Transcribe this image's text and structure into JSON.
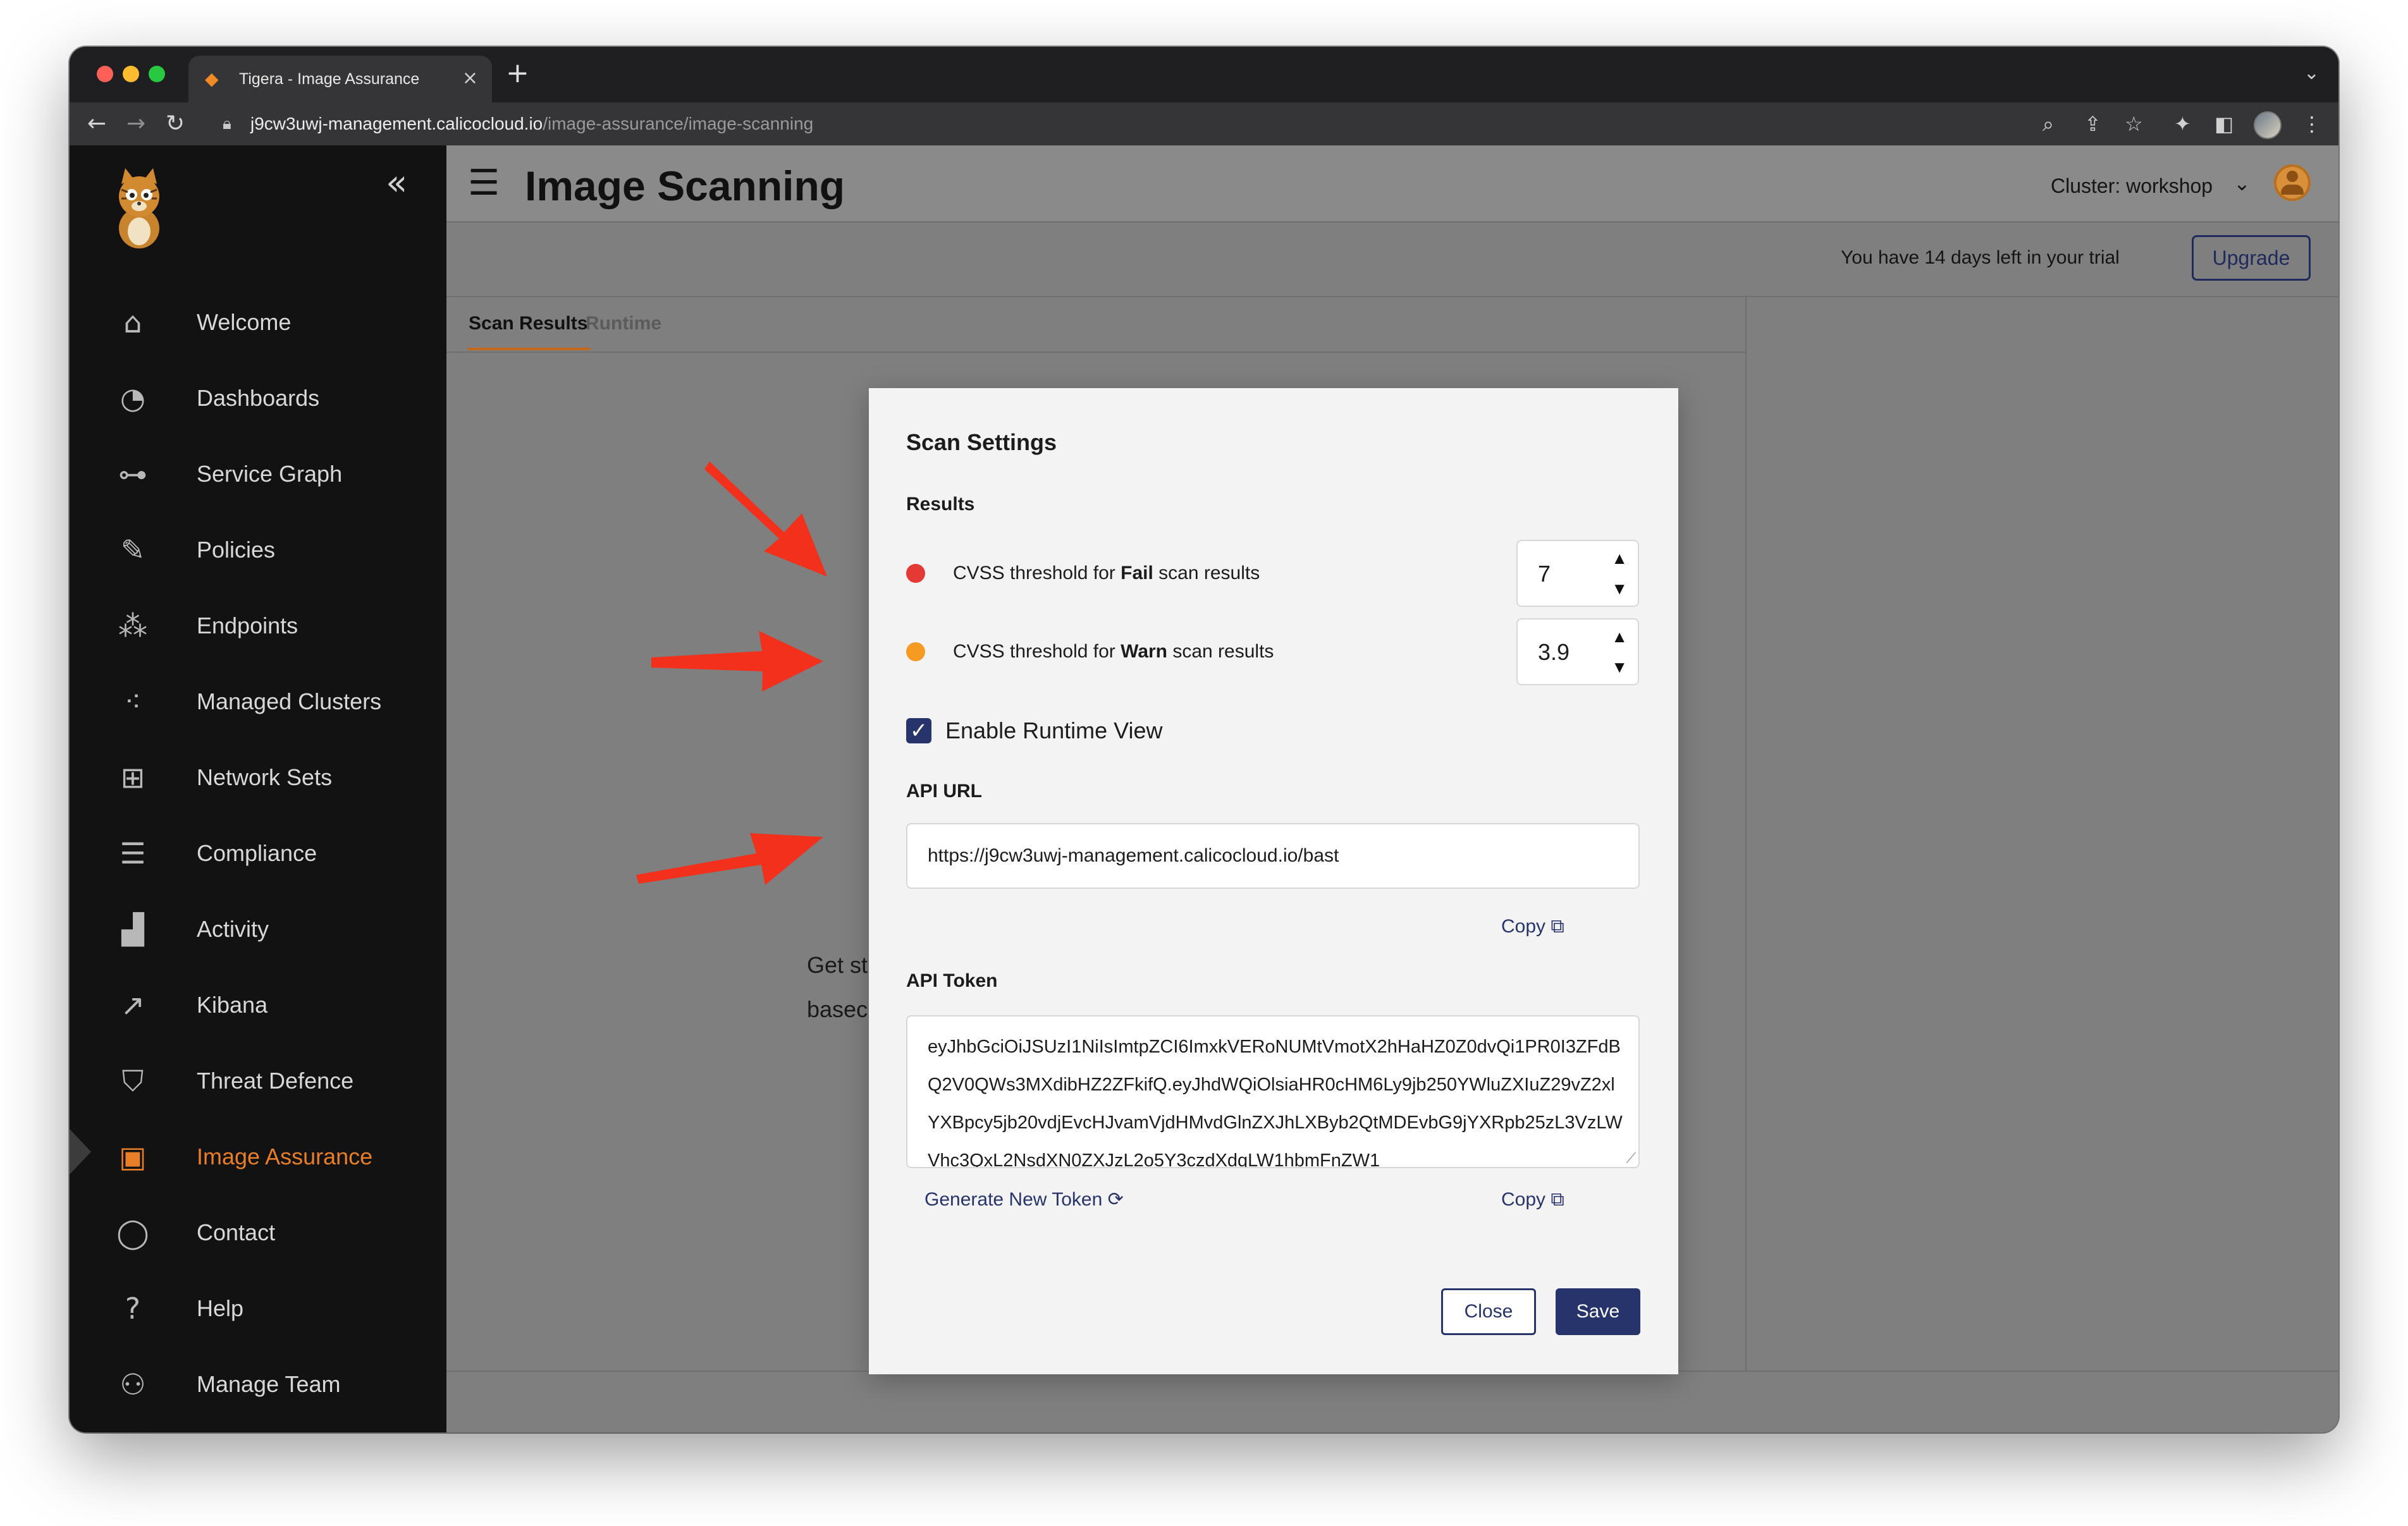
{
  "browser": {
    "tab_title": "Tigera - Image Assurance",
    "tab_close": "×",
    "new_tab": "+",
    "tab_menu": "⌄",
    "url_host": "j9cw3uwj-management.calicocloud.io",
    "url_path": "/image-assurance/image-scanning",
    "nav_back": "←",
    "nav_forward": "→",
    "nav_reload": "↻"
  },
  "sidebar": {
    "collapse_icon": "«",
    "items": [
      {
        "label": "Welcome",
        "icon": "home-icon",
        "glyph": "⌂"
      },
      {
        "label": "Dashboards",
        "icon": "dashboard-icon",
        "glyph": "◔"
      },
      {
        "label": "Service Graph",
        "icon": "service-graph-icon",
        "glyph": "⊶"
      },
      {
        "label": "Policies",
        "icon": "policies-icon",
        "glyph": "✎"
      },
      {
        "label": "Endpoints",
        "icon": "endpoints-icon",
        "glyph": "⁂"
      },
      {
        "label": "Managed Clusters",
        "icon": "managed-clusters-icon",
        "glyph": "⁖"
      },
      {
        "label": "Network Sets",
        "icon": "network-sets-icon",
        "glyph": "⊞"
      },
      {
        "label": "Compliance",
        "icon": "compliance-icon",
        "glyph": "☰"
      },
      {
        "label": "Activity",
        "icon": "activity-icon",
        "glyph": "▟"
      },
      {
        "label": "Kibana",
        "icon": "kibana-icon",
        "glyph": "↗"
      },
      {
        "label": "Threat Defence",
        "icon": "shield-icon",
        "glyph": "⛉"
      },
      {
        "label": "Image Assurance",
        "icon": "image-assurance-icon",
        "glyph": "▣",
        "active": true
      },
      {
        "label": "Contact",
        "icon": "chat-bubble-icon",
        "glyph": "◯"
      },
      {
        "label": "Help",
        "icon": "help-icon",
        "glyph": "?"
      },
      {
        "label": "Manage Team",
        "icon": "team-icon",
        "glyph": "⚇"
      }
    ]
  },
  "header": {
    "hamburger": "☰",
    "title": "Image Scanning",
    "cluster_label": "Cluster: workshop",
    "cluster_caret": "⌄",
    "trial_text": "You have 14 days left in your trial",
    "upgrade_label": "Upgrade"
  },
  "tabs": [
    "Scan Results",
    "Runtime"
  ],
  "background_text": [
    "Get st",
    "basec"
  ],
  "modal": {
    "title": "Scan Settings",
    "results_heading": "Results",
    "fail_prefix": "CVSS threshold for ",
    "fail_bold": "Fail",
    "fail_suffix": " scan results",
    "fail_value": "7",
    "warn_prefix": "CVSS threshold for ",
    "warn_bold": "Warn",
    "warn_suffix": " scan results",
    "warn_value": "3.9",
    "stepper_up": "▲",
    "stepper_down": "▼",
    "runtime_checkbox_label": "Enable Runtime View",
    "runtime_checked": true,
    "check_glyph": "✓",
    "api_url_heading": "API URL",
    "api_url_value": "https://j9cw3uwj-management.calicocloud.io/bast",
    "copy_label": "Copy",
    "copy_icon": "⧉",
    "api_token_heading": "API Token",
    "api_token_value": "eyJhbGciOiJSUzI1NiIsImtpZCI6ImxkVERoNUMtVmotX2hHaHZ0Z0dvQi1PR0I3ZFdBQ2V0QWs3MXdibHZ2ZFkifQ.eyJhdWQiOlsiaHR0cHM6Ly9jb250YWluZXIuZ29vZ2xlYXBpcy5jb20vdjEvcHJvamVjdHMvdGlnZXJhLXByb2QtMDEvbG9jYXRpb25zL3VzLWVhc3QxL2NsdXN0ZXJzL2o5Y3czdXdqLW1hbmFnZW1",
    "token_resize_glyph": "⟋",
    "generate_label": "Generate New Token",
    "generate_icon": "⟳",
    "close_label": "Close",
    "save_label": "Save"
  },
  "colors": {
    "accent": "#27336b",
    "active_nav": "#e97e29",
    "fail_dot": "#e53935",
    "warn_dot": "#f59a23",
    "annotation_arrow": "#f2301b"
  }
}
